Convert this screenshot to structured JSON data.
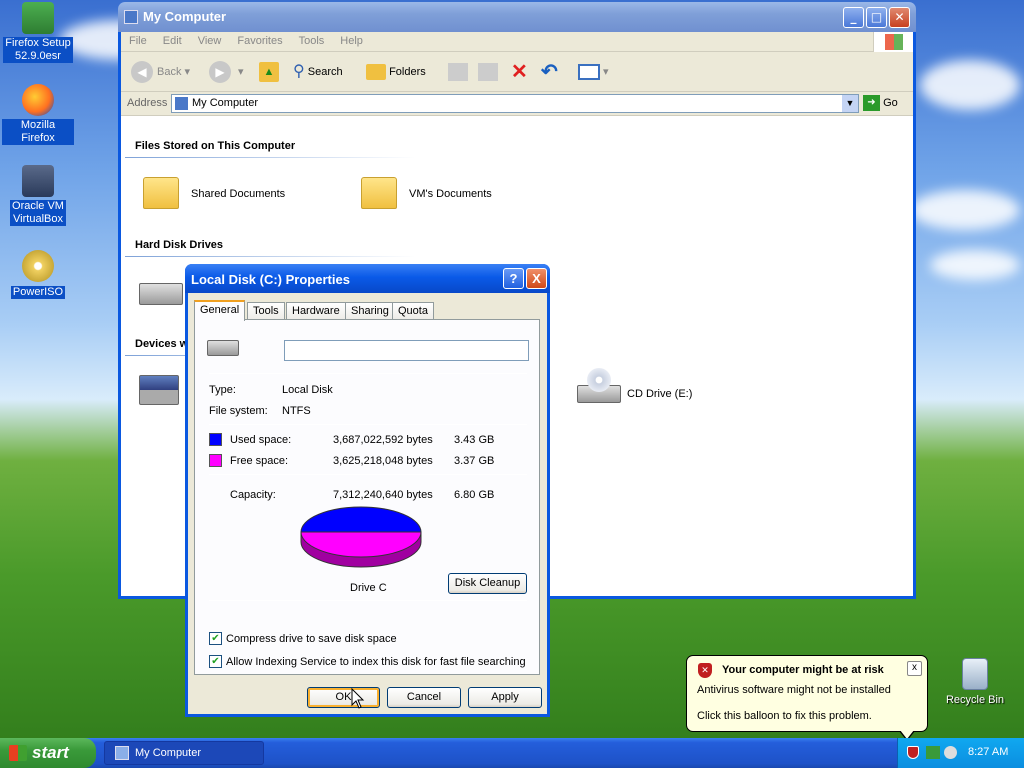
{
  "desktop": {
    "icons": [
      {
        "label_line1": "Firefox Setup",
        "label_line2": "52.9.0esr"
      },
      {
        "label_line1": "Mozilla Firefox",
        "label_line2": ""
      },
      {
        "label_line1": "Oracle VM",
        "label_line2": "VirtualBox"
      },
      {
        "label_line1": "PowerISO",
        "label_line2": ""
      },
      {
        "label_line1": "Recycle Bin",
        "label_line2": ""
      }
    ]
  },
  "explorer": {
    "title": "My Computer",
    "menu": [
      "File",
      "Edit",
      "View",
      "Favorites",
      "Tools",
      "Help"
    ],
    "toolbar": {
      "back": "Back",
      "search": "Search",
      "folders": "Folders"
    },
    "address": {
      "label": "Address",
      "value": "My Computer",
      "go": "Go"
    },
    "sections": {
      "files": "Files Stored on This Computer",
      "hdd": "Hard Disk Drives",
      "devices": "Devices w"
    },
    "items": {
      "shared_docs": "Shared Documents",
      "vm_docs": "VM's Documents",
      "cd_drive": "CD Drive (E:)"
    }
  },
  "dialog": {
    "title": "Local Disk (C:) Properties",
    "help": "?",
    "close": "X",
    "tabs": [
      "General",
      "Tools",
      "Hardware",
      "Sharing",
      "Quota"
    ],
    "name_value": "",
    "type_label": "Type:",
    "type_value": "Local Disk",
    "fs_label": "File system:",
    "fs_value": "NTFS",
    "used_label": "Used space:",
    "used_bytes": "3,687,022,592 bytes",
    "used_gb": "3.43 GB",
    "free_label": "Free space:",
    "free_bytes": "3,625,218,048 bytes",
    "free_gb": "3.37 GB",
    "cap_label": "Capacity:",
    "cap_bytes": "7,312,240,640 bytes",
    "cap_gb": "6.80 GB",
    "drive_label": "Drive C",
    "cleanup": "Disk Cleanup",
    "compress": "Compress drive to save disk space",
    "indexing": "Allow Indexing Service to index this disk for fast file searching",
    "ok": "OK",
    "cancel": "Cancel",
    "apply": "Apply",
    "used_color": "#0000ff",
    "free_color": "#ff00ff",
    "compress_checked": true,
    "indexing_checked": true
  },
  "balloon": {
    "title": "Your computer might be at risk",
    "line1": "Antivirus software might not be installed",
    "line2": "Click this balloon to fix this problem.",
    "close": "x"
  },
  "taskbar": {
    "start": "start",
    "item": "My Computer",
    "clock": "8:27 AM"
  }
}
